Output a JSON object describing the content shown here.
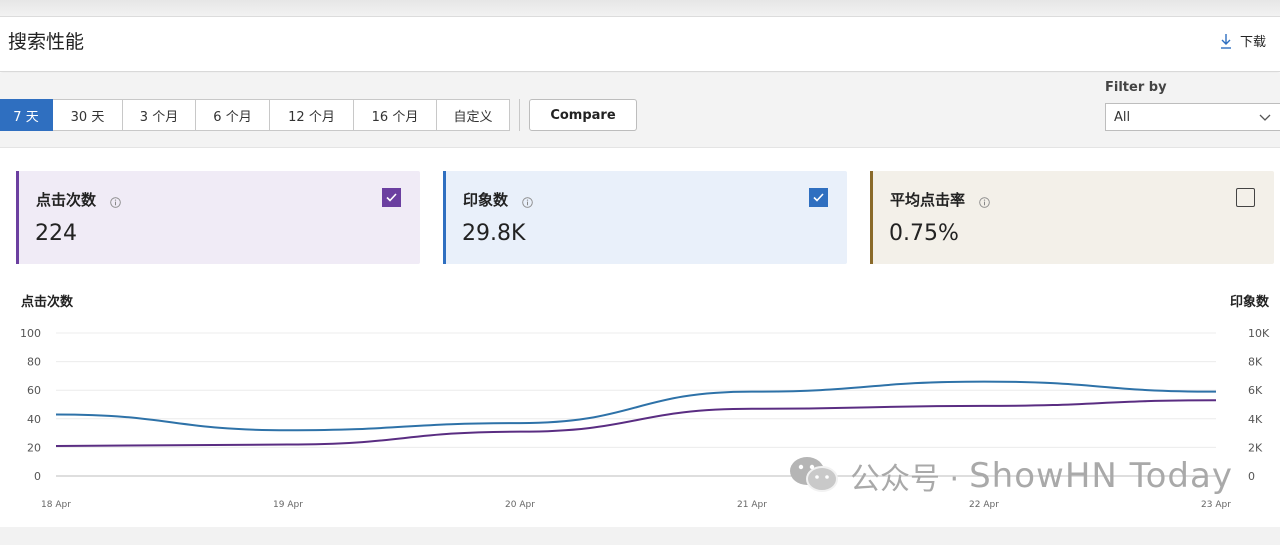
{
  "header": {
    "title": "搜索性能",
    "download_label": "下载"
  },
  "toolbar": {
    "ranges": [
      "7 天",
      "30 天",
      "3 个月",
      "6 个月",
      "12 个月",
      "16 个月",
      "自定义"
    ],
    "active_range": "7 天",
    "compare_label": "Compare",
    "filter_label": "Filter by",
    "filter_value": "All"
  },
  "cards": [
    {
      "label": "点击次数",
      "value": "224",
      "checked": true,
      "accent": "#6b3fa0",
      "bg": "#f0ebf6",
      "check_color": "#6b3fa0"
    },
    {
      "label": "印象数",
      "value": "29.8K",
      "checked": true,
      "accent": "#2f6fc0",
      "bg": "#e9f0fa",
      "check_color": "#2f6fc0"
    },
    {
      "label": "平均点击率",
      "value": "0.75%",
      "checked": false,
      "accent": "#8a6a2a",
      "bg": "#f3f0e9",
      "check_color": "#444444"
    }
  ],
  "chart_data": {
    "type": "line",
    "ylabel_left": "点击次数",
    "ylabel_right": "印象数",
    "x": [
      "18 Apr",
      "19 Apr",
      "20 Apr",
      "21 Apr",
      "22 Apr",
      "23 Apr"
    ],
    "y_left_ticks": [
      "0",
      "20",
      "40",
      "60",
      "80",
      "100"
    ],
    "y_right_ticks": [
      "0",
      "2K",
      "4K",
      "6K",
      "8K",
      "10K"
    ],
    "ylim_left": [
      0,
      100
    ],
    "ylim_right": [
      0,
      10000
    ],
    "grid": true,
    "series": [
      {
        "name": "点击次数",
        "axis": "left",
        "color": "#5a2d82",
        "values": [
          21,
          22,
          31,
          47,
          49,
          53
        ]
      },
      {
        "name": "印象数",
        "axis": "right",
        "color": "#2e72a8",
        "values": [
          4300,
          3200,
          3700,
          5900,
          6600,
          5900
        ]
      }
    ]
  },
  "watermark": {
    "cn": "公众号 ·",
    "en": "ShowHN Today"
  }
}
